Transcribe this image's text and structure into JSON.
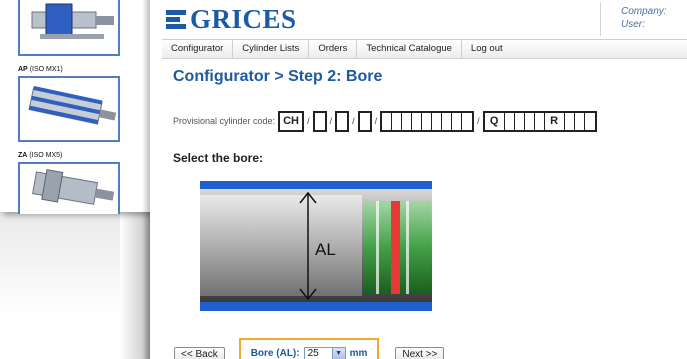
{
  "background_window": {
    "products": [
      {
        "code": "AP",
        "standard": "(ISO MX1)"
      },
      {
        "code": "ZA",
        "standard": "(ISO MX5)"
      }
    ]
  },
  "header": {
    "logo_text": "GRICES",
    "company_label": "Company:",
    "user_label": "User:"
  },
  "nav": {
    "items": [
      {
        "label": "Configurator"
      },
      {
        "label": "Cylinder Lists"
      },
      {
        "label": "Orders"
      },
      {
        "label": "Technical Catalogue"
      },
      {
        "label": "Log out"
      }
    ]
  },
  "page": {
    "title": "Configurator > Step 2: Bore",
    "code_label": "Provisional cylinder code:",
    "code_segments": {
      "first": "CH",
      "separator": "/",
      "q": "Q",
      "r": "R"
    },
    "select_label": "Select the bore:",
    "diagram_label": "AL"
  },
  "footer": {
    "back_label": "<< Back",
    "bore_label": "Bore (AL):",
    "bore_value": "25",
    "bore_unit": "mm",
    "next_label": "Next >>"
  },
  "colors": {
    "brand_blue": "#1b5aa6",
    "title_blue": "#1e5a9e",
    "highlight_orange": "#f0a830",
    "piston_green": "#4caf50",
    "seal_red": "#e53935"
  }
}
